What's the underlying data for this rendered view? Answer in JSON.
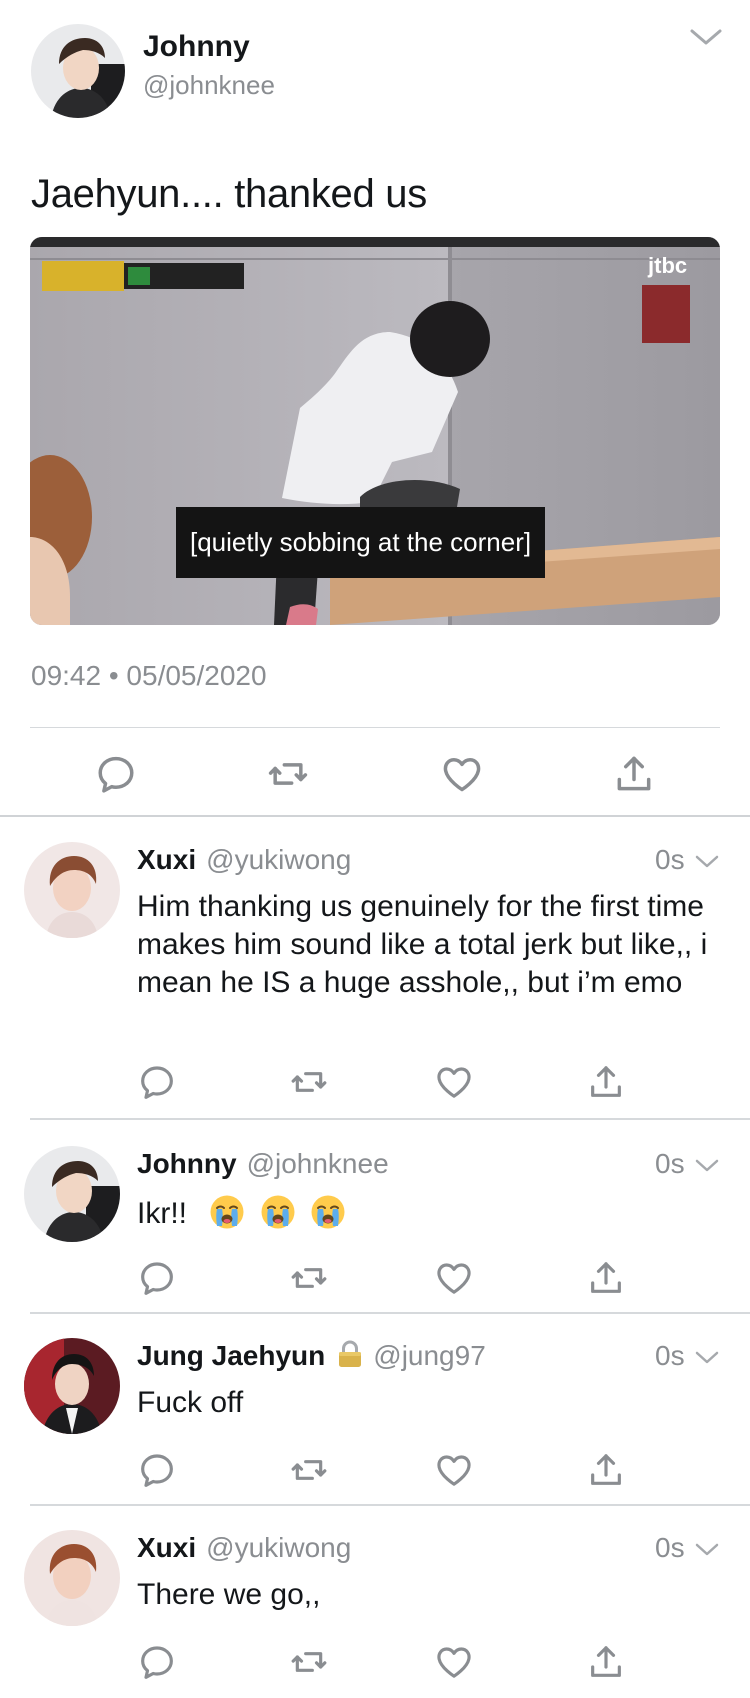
{
  "main_tweet": {
    "name": "Johnny",
    "handle": "@johnknee",
    "text": "Jaehyun.... thanked us",
    "media_caption": "[quietly sobbing at the corner]",
    "timestamp": "09:42 • 05/05/2020",
    "icons": [
      "reply-icon",
      "retweet-icon",
      "like-icon",
      "share-icon",
      "chevron-down-icon"
    ]
  },
  "replies": [
    {
      "name": "Xuxi",
      "handle": "@yukiwong",
      "time": "0s",
      "text": "Him thanking us genuinely for the first time makes him sound like a total jerk but like,, i mean he IS a huge asshole,, but i’m emo"
    },
    {
      "name": "Johnny",
      "handle": "@johnknee",
      "time": "0s",
      "text": "Ikr!!",
      "emoji": [
        "loudly-crying-face-emoji",
        "loudly-crying-face-emoji",
        "loudly-crying-face-emoji"
      ]
    },
    {
      "name": "Jung Jaehyun",
      "handle": "@jung97",
      "time": "0s",
      "text": "Fuck off",
      "locked": true
    },
    {
      "name": "Xuxi",
      "handle": "@yukiwong",
      "time": "0s",
      "text": "There we go,,"
    }
  ],
  "colors": {
    "text": "#14171a",
    "muted": "#8a8d91",
    "icon": "#8a8d91",
    "divider": "#d6d9dc"
  }
}
